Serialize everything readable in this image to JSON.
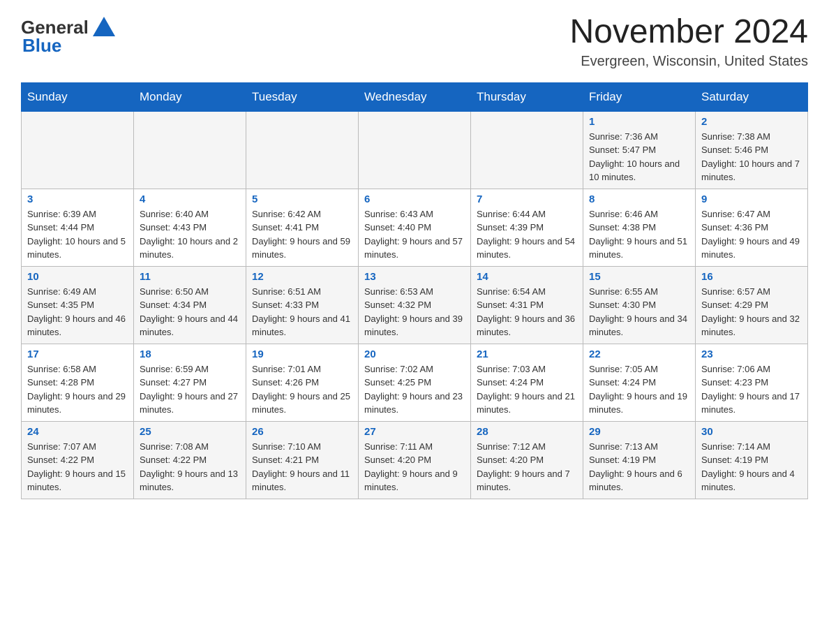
{
  "header": {
    "logo_general": "General",
    "logo_blue": "Blue",
    "month_title": "November 2024",
    "location": "Evergreen, Wisconsin, United States"
  },
  "days_of_week": [
    "Sunday",
    "Monday",
    "Tuesday",
    "Wednesday",
    "Thursday",
    "Friday",
    "Saturday"
  ],
  "weeks": [
    [
      {
        "day": "",
        "sunrise": "",
        "sunset": "",
        "daylight": ""
      },
      {
        "day": "",
        "sunrise": "",
        "sunset": "",
        "daylight": ""
      },
      {
        "day": "",
        "sunrise": "",
        "sunset": "",
        "daylight": ""
      },
      {
        "day": "",
        "sunrise": "",
        "sunset": "",
        "daylight": ""
      },
      {
        "day": "",
        "sunrise": "",
        "sunset": "",
        "daylight": ""
      },
      {
        "day": "1",
        "sunrise": "Sunrise: 7:36 AM",
        "sunset": "Sunset: 5:47 PM",
        "daylight": "Daylight: 10 hours and 10 minutes."
      },
      {
        "day": "2",
        "sunrise": "Sunrise: 7:38 AM",
        "sunset": "Sunset: 5:46 PM",
        "daylight": "Daylight: 10 hours and 7 minutes."
      }
    ],
    [
      {
        "day": "3",
        "sunrise": "Sunrise: 6:39 AM",
        "sunset": "Sunset: 4:44 PM",
        "daylight": "Daylight: 10 hours and 5 minutes."
      },
      {
        "day": "4",
        "sunrise": "Sunrise: 6:40 AM",
        "sunset": "Sunset: 4:43 PM",
        "daylight": "Daylight: 10 hours and 2 minutes."
      },
      {
        "day": "5",
        "sunrise": "Sunrise: 6:42 AM",
        "sunset": "Sunset: 4:41 PM",
        "daylight": "Daylight: 9 hours and 59 minutes."
      },
      {
        "day": "6",
        "sunrise": "Sunrise: 6:43 AM",
        "sunset": "Sunset: 4:40 PM",
        "daylight": "Daylight: 9 hours and 57 minutes."
      },
      {
        "day": "7",
        "sunrise": "Sunrise: 6:44 AM",
        "sunset": "Sunset: 4:39 PM",
        "daylight": "Daylight: 9 hours and 54 minutes."
      },
      {
        "day": "8",
        "sunrise": "Sunrise: 6:46 AM",
        "sunset": "Sunset: 4:38 PM",
        "daylight": "Daylight: 9 hours and 51 minutes."
      },
      {
        "day": "9",
        "sunrise": "Sunrise: 6:47 AM",
        "sunset": "Sunset: 4:36 PM",
        "daylight": "Daylight: 9 hours and 49 minutes."
      }
    ],
    [
      {
        "day": "10",
        "sunrise": "Sunrise: 6:49 AM",
        "sunset": "Sunset: 4:35 PM",
        "daylight": "Daylight: 9 hours and 46 minutes."
      },
      {
        "day": "11",
        "sunrise": "Sunrise: 6:50 AM",
        "sunset": "Sunset: 4:34 PM",
        "daylight": "Daylight: 9 hours and 44 minutes."
      },
      {
        "day": "12",
        "sunrise": "Sunrise: 6:51 AM",
        "sunset": "Sunset: 4:33 PM",
        "daylight": "Daylight: 9 hours and 41 minutes."
      },
      {
        "day": "13",
        "sunrise": "Sunrise: 6:53 AM",
        "sunset": "Sunset: 4:32 PM",
        "daylight": "Daylight: 9 hours and 39 minutes."
      },
      {
        "day": "14",
        "sunrise": "Sunrise: 6:54 AM",
        "sunset": "Sunset: 4:31 PM",
        "daylight": "Daylight: 9 hours and 36 minutes."
      },
      {
        "day": "15",
        "sunrise": "Sunrise: 6:55 AM",
        "sunset": "Sunset: 4:30 PM",
        "daylight": "Daylight: 9 hours and 34 minutes."
      },
      {
        "day": "16",
        "sunrise": "Sunrise: 6:57 AM",
        "sunset": "Sunset: 4:29 PM",
        "daylight": "Daylight: 9 hours and 32 minutes."
      }
    ],
    [
      {
        "day": "17",
        "sunrise": "Sunrise: 6:58 AM",
        "sunset": "Sunset: 4:28 PM",
        "daylight": "Daylight: 9 hours and 29 minutes."
      },
      {
        "day": "18",
        "sunrise": "Sunrise: 6:59 AM",
        "sunset": "Sunset: 4:27 PM",
        "daylight": "Daylight: 9 hours and 27 minutes."
      },
      {
        "day": "19",
        "sunrise": "Sunrise: 7:01 AM",
        "sunset": "Sunset: 4:26 PM",
        "daylight": "Daylight: 9 hours and 25 minutes."
      },
      {
        "day": "20",
        "sunrise": "Sunrise: 7:02 AM",
        "sunset": "Sunset: 4:25 PM",
        "daylight": "Daylight: 9 hours and 23 minutes."
      },
      {
        "day": "21",
        "sunrise": "Sunrise: 7:03 AM",
        "sunset": "Sunset: 4:24 PM",
        "daylight": "Daylight: 9 hours and 21 minutes."
      },
      {
        "day": "22",
        "sunrise": "Sunrise: 7:05 AM",
        "sunset": "Sunset: 4:24 PM",
        "daylight": "Daylight: 9 hours and 19 minutes."
      },
      {
        "day": "23",
        "sunrise": "Sunrise: 7:06 AM",
        "sunset": "Sunset: 4:23 PM",
        "daylight": "Daylight: 9 hours and 17 minutes."
      }
    ],
    [
      {
        "day": "24",
        "sunrise": "Sunrise: 7:07 AM",
        "sunset": "Sunset: 4:22 PM",
        "daylight": "Daylight: 9 hours and 15 minutes."
      },
      {
        "day": "25",
        "sunrise": "Sunrise: 7:08 AM",
        "sunset": "Sunset: 4:22 PM",
        "daylight": "Daylight: 9 hours and 13 minutes."
      },
      {
        "day": "26",
        "sunrise": "Sunrise: 7:10 AM",
        "sunset": "Sunset: 4:21 PM",
        "daylight": "Daylight: 9 hours and 11 minutes."
      },
      {
        "day": "27",
        "sunrise": "Sunrise: 7:11 AM",
        "sunset": "Sunset: 4:20 PM",
        "daylight": "Daylight: 9 hours and 9 minutes."
      },
      {
        "day": "28",
        "sunrise": "Sunrise: 7:12 AM",
        "sunset": "Sunset: 4:20 PM",
        "daylight": "Daylight: 9 hours and 7 minutes."
      },
      {
        "day": "29",
        "sunrise": "Sunrise: 7:13 AM",
        "sunset": "Sunset: 4:19 PM",
        "daylight": "Daylight: 9 hours and 6 minutes."
      },
      {
        "day": "30",
        "sunrise": "Sunrise: 7:14 AM",
        "sunset": "Sunset: 4:19 PM",
        "daylight": "Daylight: 9 hours and 4 minutes."
      }
    ]
  ]
}
